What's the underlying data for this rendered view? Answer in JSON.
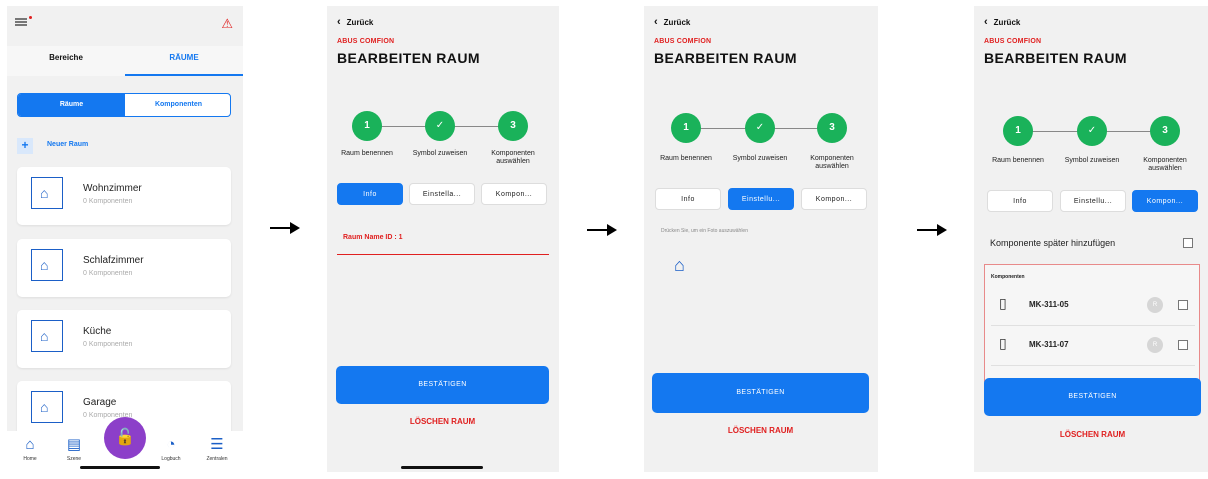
{
  "screen1": {
    "tabs": [
      "Bereiche",
      "RÄUME"
    ],
    "segment": [
      "Räume",
      "Komponenten"
    ],
    "new_room": "Neuer Raum",
    "rooms": [
      {
        "name": "Wohnzimmer",
        "sub": "0 Komponenten"
      },
      {
        "name": "Schlafzimmer",
        "sub": "0 Komponenten"
      },
      {
        "name": "Küche",
        "sub": "0 Komponenten"
      },
      {
        "name": "Garage",
        "sub": "0 Komponenten"
      }
    ],
    "nav": [
      "Home",
      "Szene",
      "Logbuch",
      "Zentralen"
    ]
  },
  "common": {
    "back": "Zurück",
    "brand": "ABUS COMFION",
    "title": "BEARBEITEN RAUM",
    "steps": [
      {
        "num": "1",
        "label": "Raum benennen"
      },
      {
        "num": "✓",
        "label": "Symbol zuweisen"
      },
      {
        "num": "3",
        "label": "Komponenten auswählen"
      }
    ],
    "pills": [
      "Info",
      "Einstellu...",
      "Kompon..."
    ],
    "confirm": "BESTÄTIGEN",
    "delete": "LÖSCHEN RAUM"
  },
  "screen2": {
    "pills": [
      "Info",
      "Einstella...",
      "Kompon..."
    ],
    "field_label": "Raum Name  ID : 1"
  },
  "screen3": {
    "hint": "Drücken Sie, um ein Foto auszuwählen"
  },
  "screen4": {
    "later": "Komponente später hinzufügen",
    "comp_header": "Komponenten",
    "components": [
      {
        "name": "MK-311-05",
        "badge": "R"
      },
      {
        "name": "MK-311-07",
        "badge": "R"
      }
    ]
  }
}
